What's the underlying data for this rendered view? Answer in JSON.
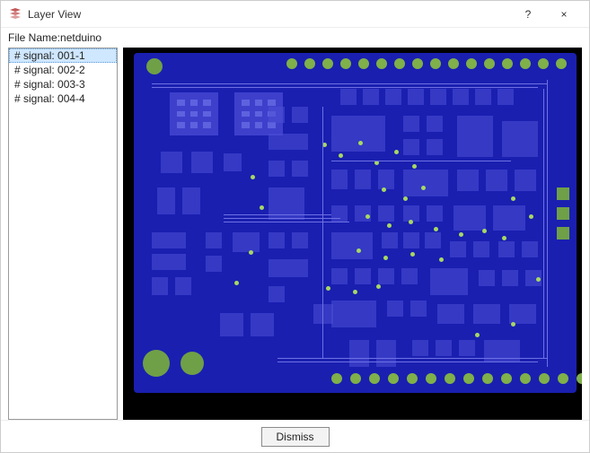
{
  "window": {
    "title": "Layer View",
    "help_symbol": "?",
    "close_symbol": "×"
  },
  "file": {
    "label_prefix": "File Name:",
    "name": "netduino"
  },
  "signals": {
    "items": [
      {
        "label": "# signal: 001-1",
        "selected": true
      },
      {
        "label": "# signal: 002-2",
        "selected": false
      },
      {
        "label": "# signal: 003-3",
        "selected": false
      },
      {
        "label": "# signal: 004-4",
        "selected": false
      }
    ]
  },
  "buttons": {
    "dismiss": "Dismiss"
  }
}
